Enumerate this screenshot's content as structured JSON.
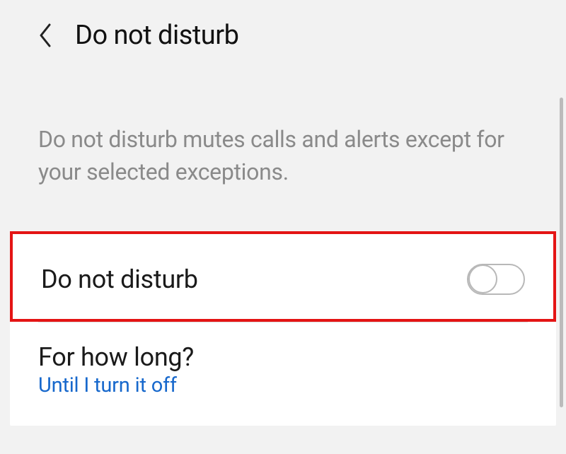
{
  "header": {
    "title": "Do not disturb"
  },
  "description": "Do not disturb mutes calls and alerts except for your selected exceptions.",
  "dnd": {
    "label": "Do not disturb",
    "enabled": false
  },
  "duration": {
    "label": "For how long?",
    "value": "Until I turn it off"
  }
}
